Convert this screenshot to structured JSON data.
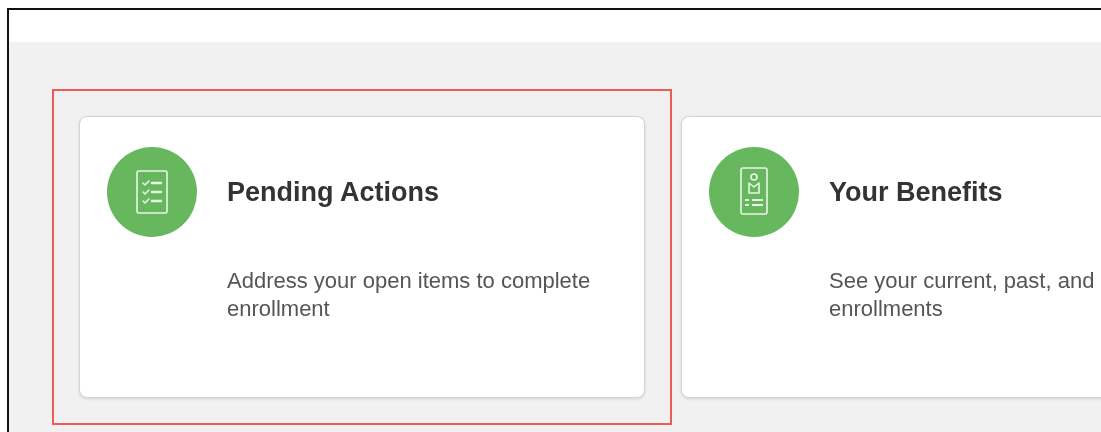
{
  "cards": [
    {
      "title": "Pending Actions",
      "description_lines": [
        "Address your open items to complete",
        "enrollment"
      ],
      "highlighted": true
    },
    {
      "title": "Your Benefits",
      "description_lines": [
        "See your current, past, and",
        "enrollments"
      ],
      "highlighted": false
    }
  ]
}
